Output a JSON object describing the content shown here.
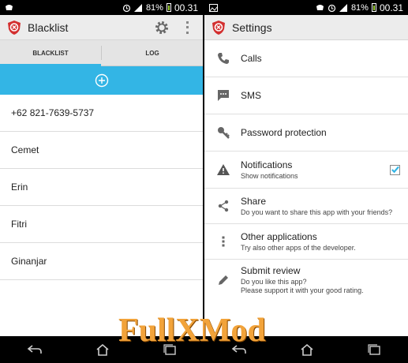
{
  "left": {
    "status": {
      "battery": "81%",
      "time": "00.31"
    },
    "app_title": "Blacklist",
    "tabs": [
      "BLACKLIST",
      "LOG"
    ],
    "entries": [
      "+62 821-7639-5737",
      "Cemet",
      "Erin",
      "Fitri",
      "Ginanjar"
    ]
  },
  "right": {
    "status": {
      "battery": "81%",
      "time": "00.31"
    },
    "app_title": "Settings",
    "items": [
      {
        "title": "Calls",
        "icon": "phone-icon"
      },
      {
        "title": "SMS",
        "icon": "sms-icon"
      },
      {
        "title": "Password protection",
        "icon": "key-icon"
      },
      {
        "title": "Notifications",
        "sub": "Show notifications",
        "icon": "warning-icon",
        "checked": true
      },
      {
        "title": "Share",
        "sub": "Do you want to share this app with your friends?",
        "icon": "share-icon"
      },
      {
        "title": "Other applications",
        "sub": "Try also other apps of the developer.",
        "icon": "more-vertical-icon"
      },
      {
        "title": "Submit review",
        "sub": "Do you like this app?\nPlease support it with your good rating.",
        "icon": "pencil-icon"
      }
    ]
  },
  "watermark": {
    "part1": "Full",
    "part2": "X",
    "part3": "Mod"
  },
  "colors": {
    "accent": "#33b5e5",
    "statusbar": "#000000",
    "actionbar": "#ececec",
    "checkbox": "#33b5e5"
  }
}
